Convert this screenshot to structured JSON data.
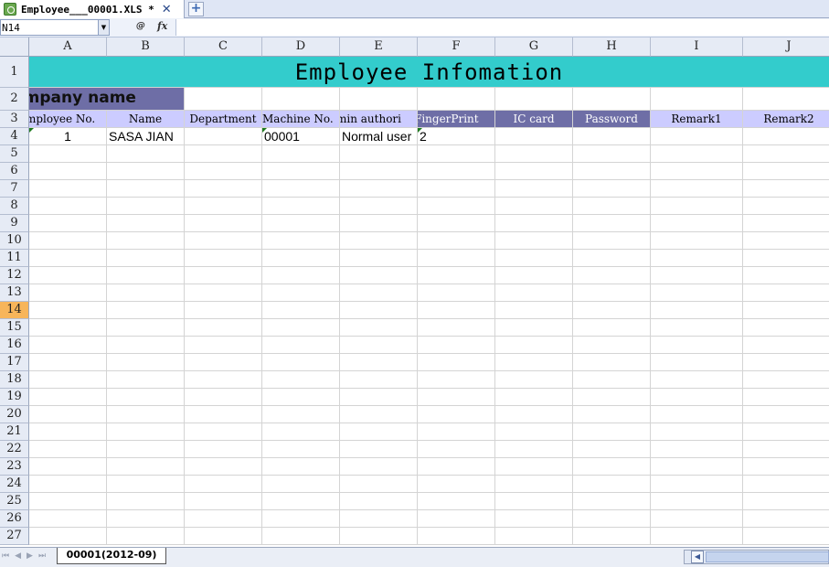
{
  "file_tab": {
    "title": "Employee___00001.XLS *",
    "close_symbol": "✕",
    "new_tab_symbol": "+"
  },
  "formula_bar": {
    "cell_ref": "N14",
    "zoom_symbol": "@",
    "fx_symbol": "fx",
    "content": ""
  },
  "columns": [
    "A",
    "B",
    "C",
    "D",
    "E",
    "F",
    "G",
    "H",
    "I",
    "J"
  ],
  "rows": [
    "1",
    "2",
    "3",
    "4",
    "5",
    "6",
    "7",
    "8",
    "9",
    "10",
    "11",
    "12",
    "13",
    "14",
    "15",
    "16",
    "17",
    "18",
    "19",
    "20",
    "21",
    "22",
    "23",
    "24",
    "25",
    "26",
    "27"
  ],
  "active_row": "14",
  "sheet": {
    "title": "Employee Infomation",
    "company_label": "ompany name",
    "headers": [
      "mployee No.",
      "Name",
      "Department",
      "Machine No.",
      "min authori",
      "FingerPrint",
      "IC card",
      "Password",
      "Remark1",
      "Remark2"
    ],
    "row4": [
      "1",
      "SASA JIAN",
      "",
      "00001",
      "Normal user",
      "2",
      "",
      "",
      "",
      ""
    ]
  },
  "sheet_tabs": {
    "active": "00001(2012-09)"
  },
  "colors": {
    "title_fill": "#33cccc",
    "company_fill": "#6e6ea6",
    "header_fill": "#ccccff",
    "active_row_header": "#f7b55a"
  }
}
